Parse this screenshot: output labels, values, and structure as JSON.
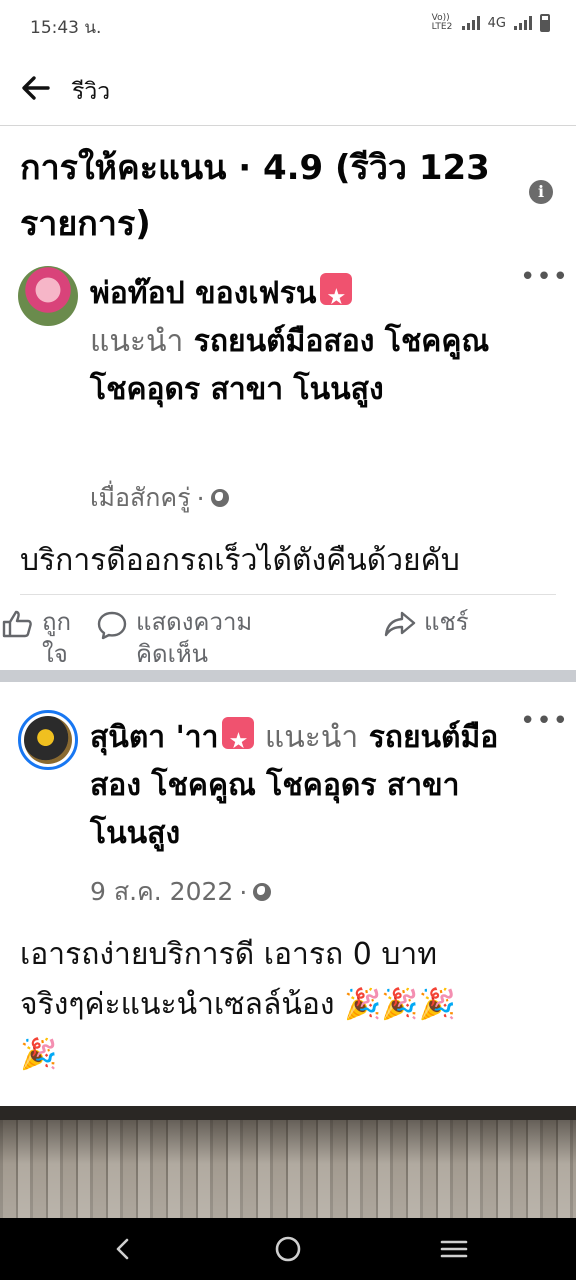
{
  "status_bar": {
    "time": "15:43 น.",
    "network_label": "Vo)) LTE2",
    "network_type": "4G"
  },
  "app_bar": {
    "back_icon": "arrow-left-icon",
    "title": "รีวิว"
  },
  "page": {
    "heading": "การให้คะแนน · 4.9 (รีวิว 123 รายการ)",
    "info_icon": "info-icon"
  },
  "reviews": [
    {
      "author": "พ่อท๊อป ของเฟรน",
      "recommends_label": "แนะนำ",
      "business": "รถยนต์มือสอง โชคคูณโชคอุดร สาขา โนนสูง",
      "time": "เมื่อสักครู่",
      "text": "บริการดีออกรถเร็วได้ตังคืนด้วยคับ",
      "actions": {
        "like": "ถูกใจ",
        "comment": "แสดงความคิดเห็น",
        "share": "แชร์"
      }
    },
    {
      "author": "สุนิตา 'าา",
      "recommends_label": "แนะนำ",
      "business": "รถยนต์มือสอง โชคคูณ โชคอุดร สาขา โนนสูง",
      "time": "9 ส.ค. 2022",
      "text_line1": "เอารถง่ายบริการดี  เอารถ 0 บาท",
      "text_line2": "จริงๆค่ะแนะนำเซลล์น้อง 🎉🎉🎉",
      "text_line3": "🎉"
    }
  ],
  "colors": {
    "badge": "#f0526f",
    "muted_text": "#6b6b6b",
    "action_text": "#65676b",
    "avatar_ring": "#1877f2"
  }
}
